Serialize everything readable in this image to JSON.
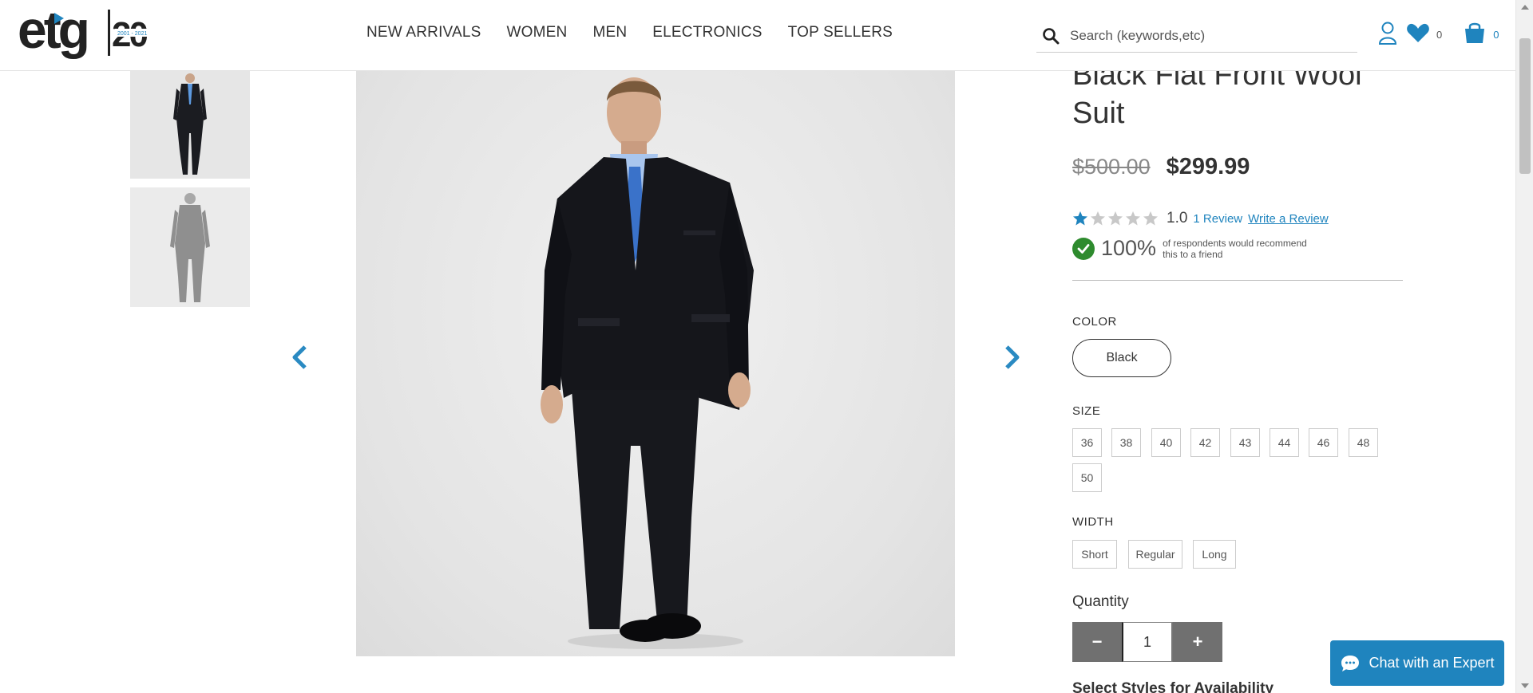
{
  "header": {
    "logo_text": "etg",
    "logo_badge": "20",
    "nav": [
      "NEW ARRIVALS",
      "WOMEN",
      "MEN",
      "ELECTRONICS",
      "TOP SELLERS"
    ],
    "search_placeholder": "Search (keywords,etc)",
    "wishlist_count": "0",
    "cart_count": "0"
  },
  "product": {
    "title": "Black Flat Front Wool Suit",
    "price_old": "$500.00",
    "price_new": "$299.99",
    "rating_value": "1.0",
    "rating_stars": 1,
    "rating_max": 5,
    "reviews_link": "1 Review",
    "write_review": "Write a Review",
    "recommend_pct": "100%",
    "recommend_text": "of respondents would recommend this to a friend"
  },
  "options": {
    "color_label": "COLOR",
    "color_value": "Black",
    "size_label": "SIZE",
    "sizes": [
      "36",
      "38",
      "40",
      "42",
      "43",
      "44",
      "46",
      "48",
      "50"
    ],
    "width_label": "WIDTH",
    "widths": [
      "Short",
      "Regular",
      "Long"
    ],
    "quantity_label": "Quantity",
    "quantity_value": "1",
    "minus": "−",
    "plus": "+",
    "availability_label": "Select Styles for Availability"
  },
  "chat": {
    "label": "Chat with an Expert"
  },
  "colors": {
    "accent": "#1f84be",
    "success": "#2e8b2e",
    "qty_button": "#707070"
  }
}
